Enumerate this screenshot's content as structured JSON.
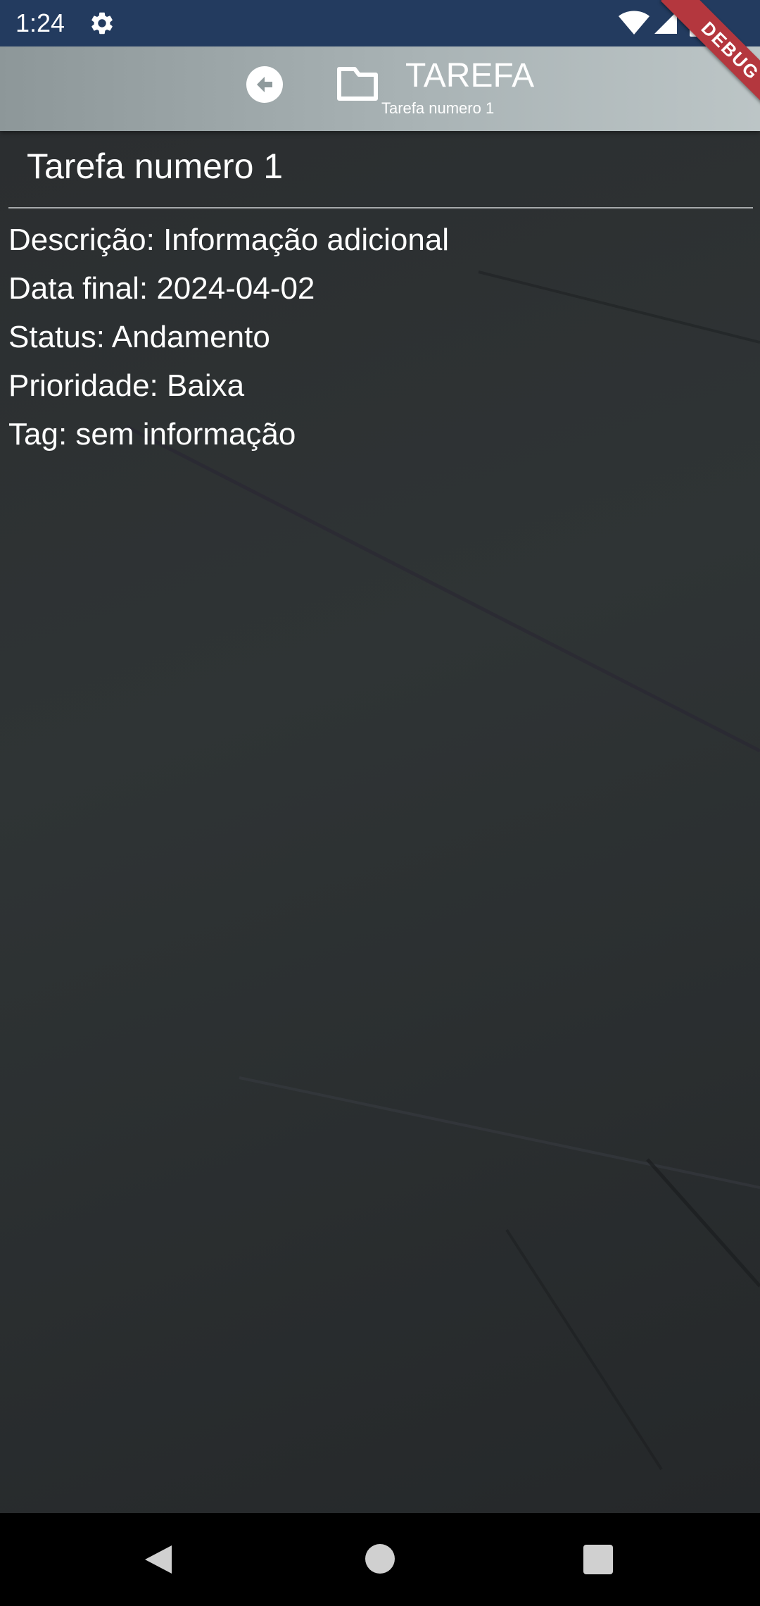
{
  "status_bar": {
    "time": "1:24",
    "icons": [
      "gear-icon",
      "wifi-icon",
      "signal-icon",
      "battery-icon"
    ],
    "background": "#233b5f"
  },
  "debug_banner": {
    "label": "DEBUG",
    "color": "#b4373e"
  },
  "app_bar": {
    "title": "TAREFA",
    "subtitle": "Tarefa numero 1",
    "icons": [
      "back-arrow-circle-icon",
      "folder-icon"
    ]
  },
  "task": {
    "title": "Tarefa numero 1",
    "details": [
      "Descrição: Informação adicional",
      "Data final: 2024-04-02",
      "Status: Andamento",
      "Prioridade: Baixa",
      "Tag: sem informação"
    ]
  },
  "nav_bar": {
    "icons": [
      "nav-back-icon",
      "nav-home-icon",
      "nav-recents-icon"
    ]
  }
}
